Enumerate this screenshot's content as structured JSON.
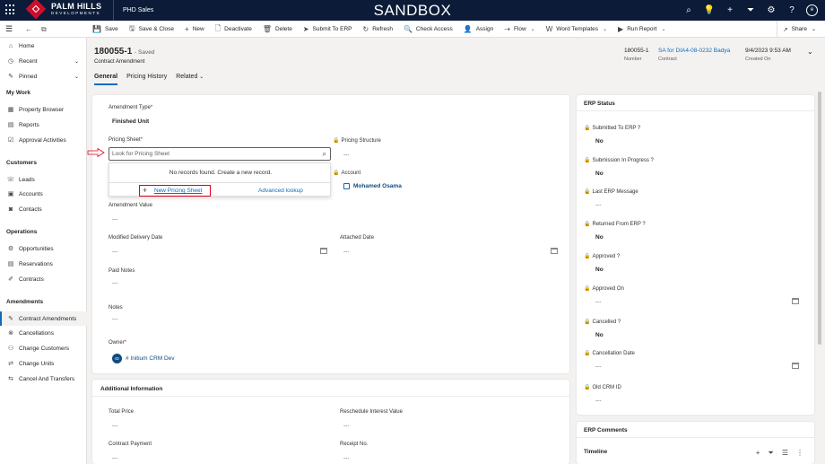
{
  "app": {
    "brand": "PALM HILLS",
    "brand_sub": "DEVELOPMENTS",
    "app_name": "PHD Sales",
    "environment": "SANDBOX",
    "user_initial": "e"
  },
  "commands": [
    {
      "icon": "save-icon",
      "glyph": "💾",
      "label": "Save"
    },
    {
      "icon": "save-close-icon",
      "glyph": "🖫",
      "label": "Save & Close"
    },
    {
      "icon": "plus-icon",
      "glyph": "+",
      "label": "New"
    },
    {
      "icon": "deactivate-icon",
      "glyph": "🗋",
      "label": "Deactivate"
    },
    {
      "icon": "trash-icon",
      "glyph": "🗑",
      "label": "Delete"
    },
    {
      "icon": "submit-icon",
      "glyph": "➤",
      "label": "Submit To ERP"
    },
    {
      "icon": "refresh-icon",
      "glyph": "↻",
      "label": "Refresh"
    },
    {
      "icon": "check-access-icon",
      "glyph": "🔍",
      "label": "Check Access"
    },
    {
      "icon": "assign-icon",
      "glyph": "👤",
      "label": "Assign"
    },
    {
      "icon": "flow-icon",
      "glyph": "⇢",
      "label": "Flow"
    },
    {
      "icon": "word-icon",
      "glyph": "W",
      "label": "Word Templates"
    },
    {
      "icon": "report-icon",
      "glyph": "▶",
      "label": "Run Report"
    }
  ],
  "share_label": "Share",
  "sidebar": {
    "top": [
      {
        "label": "Home",
        "icon": "home-icon",
        "glyph": "⌂"
      },
      {
        "label": "Recent",
        "icon": "clock-icon",
        "glyph": "◷"
      },
      {
        "label": "Pinned",
        "icon": "pin-icon",
        "glyph": "✎"
      }
    ],
    "my_work_title": "My Work",
    "my_work": [
      {
        "label": "Property Browser",
        "icon": "grid-icon",
        "glyph": "▦"
      },
      {
        "label": "Reports",
        "icon": "report-icon",
        "glyph": "▤"
      },
      {
        "label": "Approval Activities",
        "icon": "approval-icon",
        "glyph": "☑"
      }
    ],
    "customers_title": "Customers",
    "customers": [
      {
        "label": "Leads",
        "icon": "phone-icon",
        "glyph": "☏"
      },
      {
        "label": "Accounts",
        "icon": "accounts-icon",
        "glyph": "▣"
      },
      {
        "label": "Contacts",
        "icon": "contacts-icon",
        "glyph": "◙"
      }
    ],
    "operations_title": "Operations",
    "operations": [
      {
        "label": "Opportunities",
        "icon": "opportunity-icon",
        "glyph": "⚙"
      },
      {
        "label": "Reservations",
        "icon": "reservation-icon",
        "glyph": "▤"
      },
      {
        "label": "Contracts",
        "icon": "contract-icon",
        "glyph": "✐"
      }
    ],
    "amendments_title": "Amendments",
    "amendments": [
      {
        "label": "Contract Amendments",
        "icon": "amendment-icon",
        "glyph": "✎"
      },
      {
        "label": "Cancellations",
        "icon": "cancel-icon",
        "glyph": "⊗"
      },
      {
        "label": "Change Customers",
        "icon": "people-icon",
        "glyph": "⚇"
      },
      {
        "label": "Change Units",
        "icon": "units-icon",
        "glyph": "⇄"
      },
      {
        "label": "Cancel And Transfers",
        "icon": "transfer-icon",
        "glyph": "⇆"
      }
    ]
  },
  "record": {
    "title": "180055-1",
    "saved": "- Saved",
    "entity": "Contract Amendment",
    "header_fields": [
      {
        "value": "180055-1",
        "label": "Number"
      },
      {
        "value": "SA for DIA4-08-0232 Badya",
        "label": "Contract"
      },
      {
        "value": "9/4/2023 9:53 AM",
        "label": "Created On"
      }
    ]
  },
  "tabs": [
    "General",
    "Pricing History",
    "Related"
  ],
  "general": {
    "amendment_type_label": "Amendment Type",
    "amendment_type_value": "Finished Unit",
    "pricing_sheet_label": "Pricing Sheet",
    "pricing_sheet_placeholder": "Look for Pricing Sheet",
    "no_records": "No records found. Create a new record.",
    "new_pricing_sheet": "New Pricing Sheet",
    "advanced_lookup": "Advanced lookup",
    "pricing_structure_label": "Pricing Structure",
    "pricing_structure_value": "---",
    "account_label": "Account",
    "account_value": "Mohamed Osama",
    "amendment_value_label": "Amendment Value",
    "amendment_value_value": "---",
    "modified_delivery_label": "Modified Delivery Date",
    "modified_delivery_value": "---",
    "attached_date_label": "Attached Date",
    "attached_date_value": "---",
    "paid_notes_label": "Paid Notes",
    "paid_notes_value": "---",
    "notes_label": "Notes",
    "notes_value": "---",
    "owner_label": "Owner",
    "owner_initials": "ID",
    "owner_value": "# Initium CRM Dev",
    "required_mark": "*"
  },
  "additional": {
    "title": "Additional Information",
    "total_price_label": "Total Price",
    "total_price_value": "---",
    "reschedule_label": "Reschedule Interest Value",
    "reschedule_value": "---",
    "contract_payment_label": "Contract Payment",
    "contract_payment_value": "---",
    "receipt_label": "Receipt No.",
    "receipt_value": "---"
  },
  "erp": {
    "title": "ERP Status",
    "fields": [
      {
        "label": "Submitted To ERP ?",
        "value": "No"
      },
      {
        "label": "Submission In Progress ?",
        "value": "No"
      },
      {
        "label": "Last ERP Message",
        "value": "---"
      },
      {
        "label": "Returned From ERP ?",
        "value": "No"
      },
      {
        "label": "Approved ?",
        "value": "No"
      },
      {
        "label": "Approved On",
        "value": "---"
      },
      {
        "label": "Cancelled ?",
        "value": "No"
      },
      {
        "label": "Cancellation Date",
        "value": "---"
      },
      {
        "label": "Old CRM ID",
        "value": "---"
      }
    ]
  },
  "erp_comments": {
    "title": "ERP Comments",
    "timeline": "Timeline"
  }
}
